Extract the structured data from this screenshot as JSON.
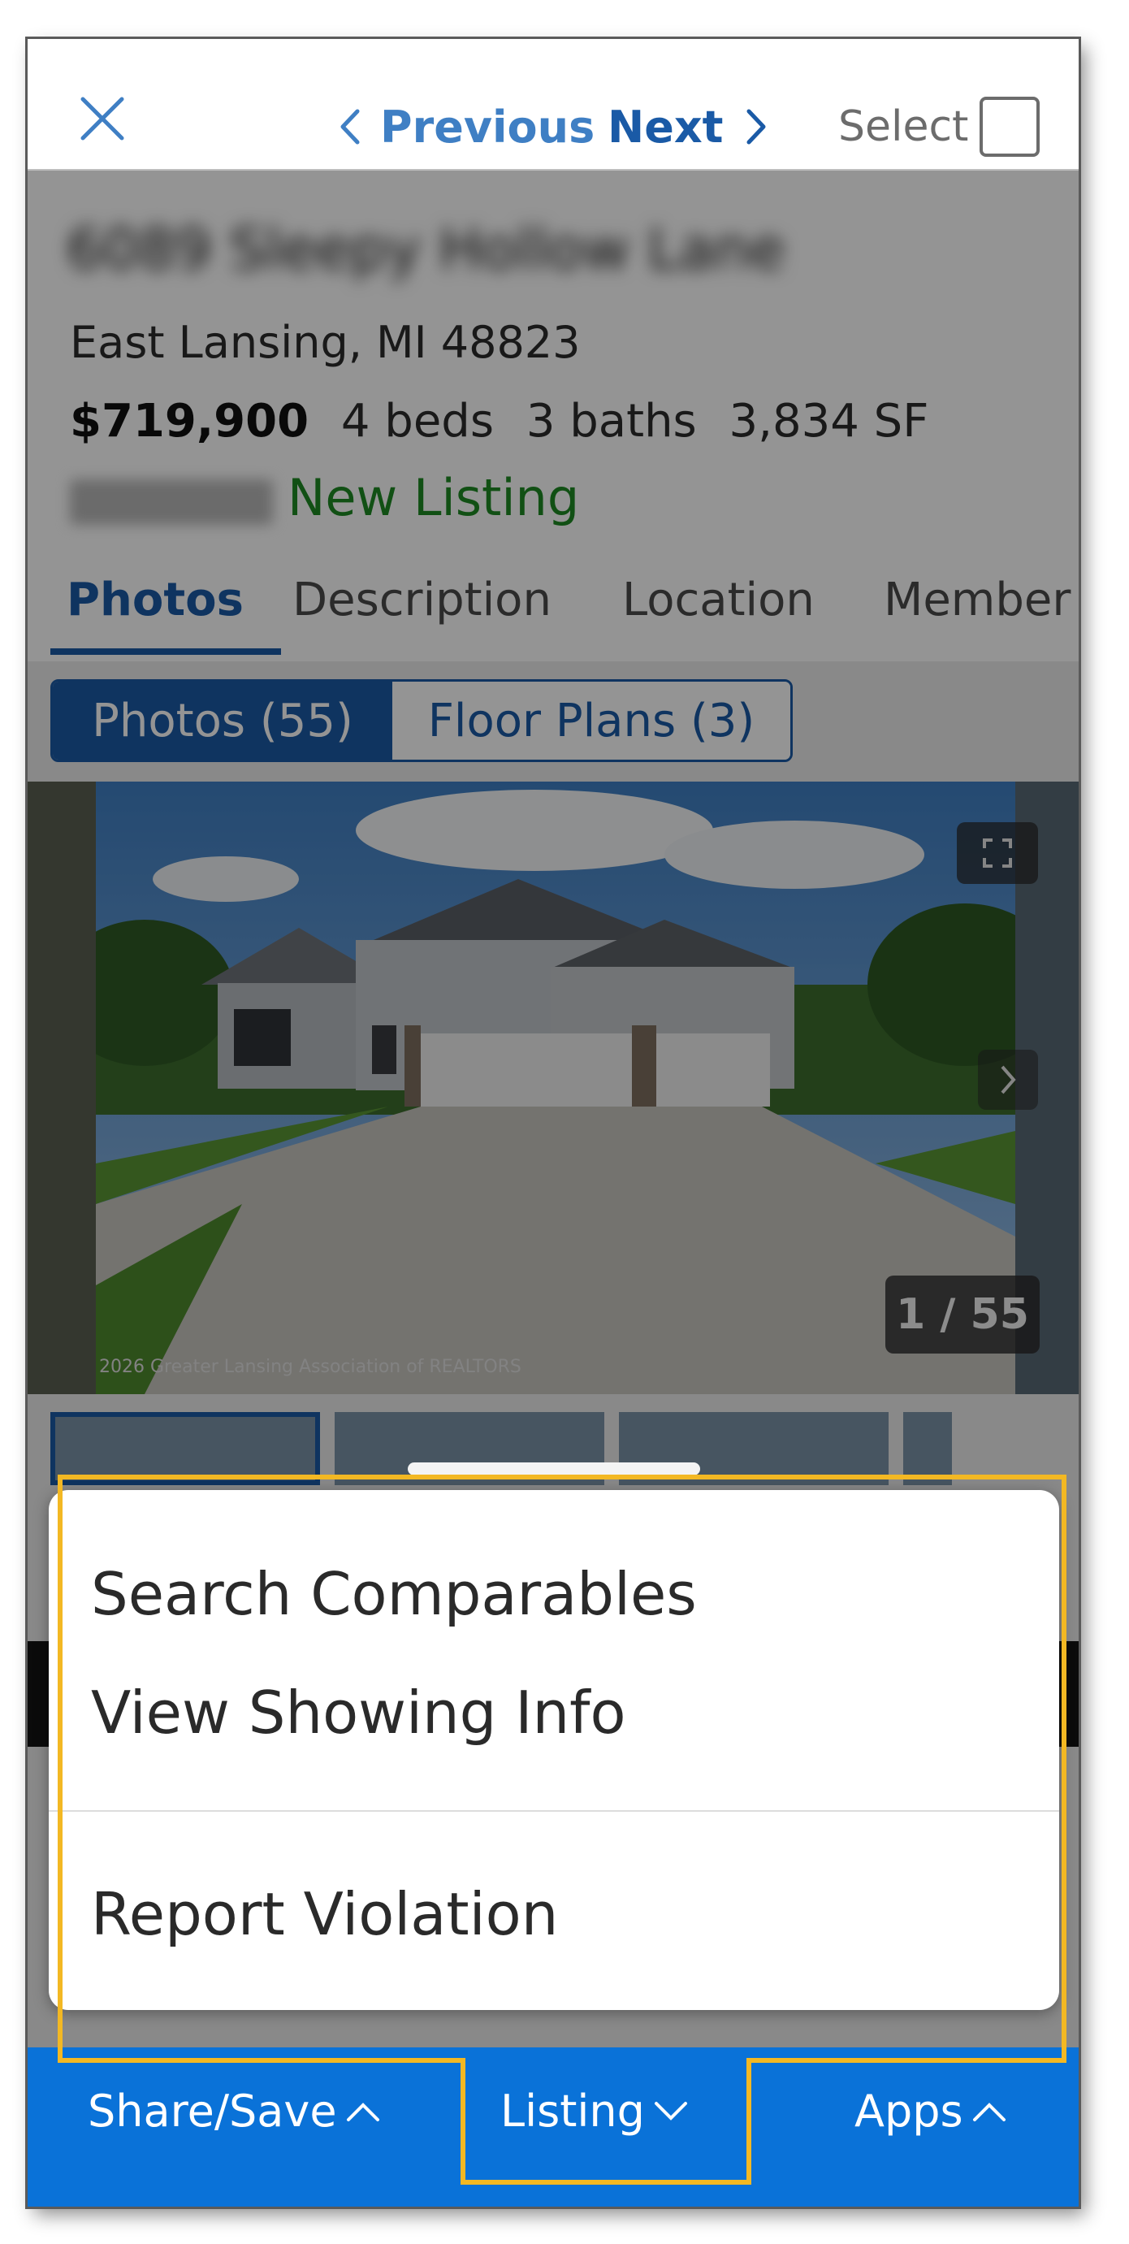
{
  "topnav": {
    "previous_label": "Previous",
    "next_label": "Next",
    "select_label": "Select"
  },
  "listing": {
    "address_line1": "6089 Sleepy Hollow Lane",
    "city_line": "East Lansing, MI 48823",
    "price": "$719,900",
    "beds": "4 beds",
    "baths": "3 baths",
    "sqft": "3,834 SF",
    "status": "New Listing"
  },
  "tabs": [
    "Photos",
    "Description",
    "Location",
    "Member"
  ],
  "segments": {
    "photos": "Photos (55)",
    "floor_plans": "Floor Plans (3)"
  },
  "photo": {
    "counter": "1 / 55",
    "copyright": "2026 Greater Lansing Association of REALTORS"
  },
  "menu": {
    "items": [
      "Search Comparables",
      "View Showing Info",
      "Report Violation"
    ]
  },
  "bottombar": {
    "share_save": "Share/Save",
    "listing": "Listing",
    "apps": "Apps"
  },
  "colors": {
    "brand_blue": "#1a5aa6",
    "bar_blue": "#0a72d8",
    "status_green": "#1e8a24",
    "highlight_yellow": "#f3b823"
  }
}
